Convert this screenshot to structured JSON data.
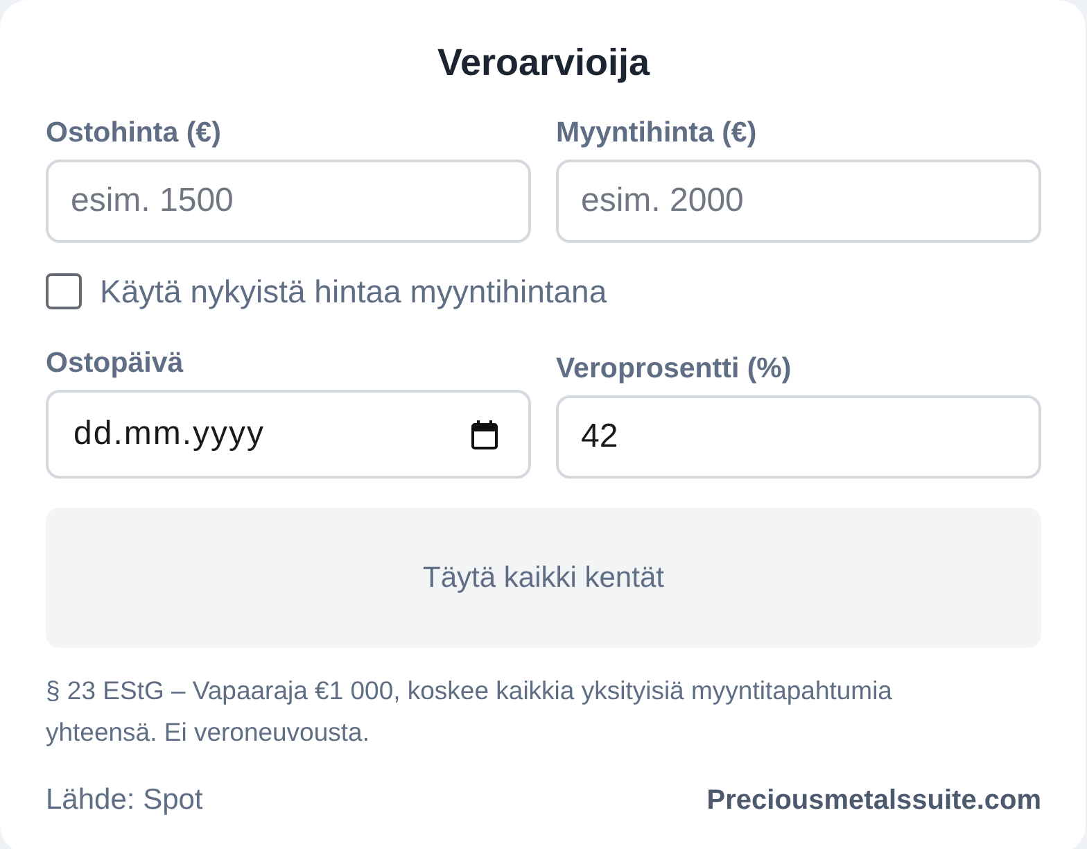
{
  "title": "Veroarvioija",
  "fields": [
    {
      "label": "Ostohinta (€)",
      "kind": "number",
      "placeholder": "esim. 1500"
    },
    {
      "label": "Myyntihinta (€)",
      "kind": "number",
      "placeholder": "esim. 2000"
    }
  ],
  "checkbox": {
    "label": "Käytä nykyistä hintaa myyntihintana",
    "checked": false
  },
  "fields_2": [
    {
      "label": "Ostopäivä",
      "kind": "date",
      "placeholder": "dd.mm.yyyy"
    },
    {
      "label": "Veroprosentti (%)",
      "kind": "number",
      "value": "42"
    }
  ],
  "result": {
    "message": "Täytä kaikki kentät"
  },
  "note": "§ 23 EStG – Vapaaraja €1 000, koskee kaikkia yksityisiä myyntitapahtumia yhteensä. Ei veroneuvousta.",
  "footer": {
    "source": "Lähde: Spot",
    "link": "Preciousmetalssuite.com"
  }
}
